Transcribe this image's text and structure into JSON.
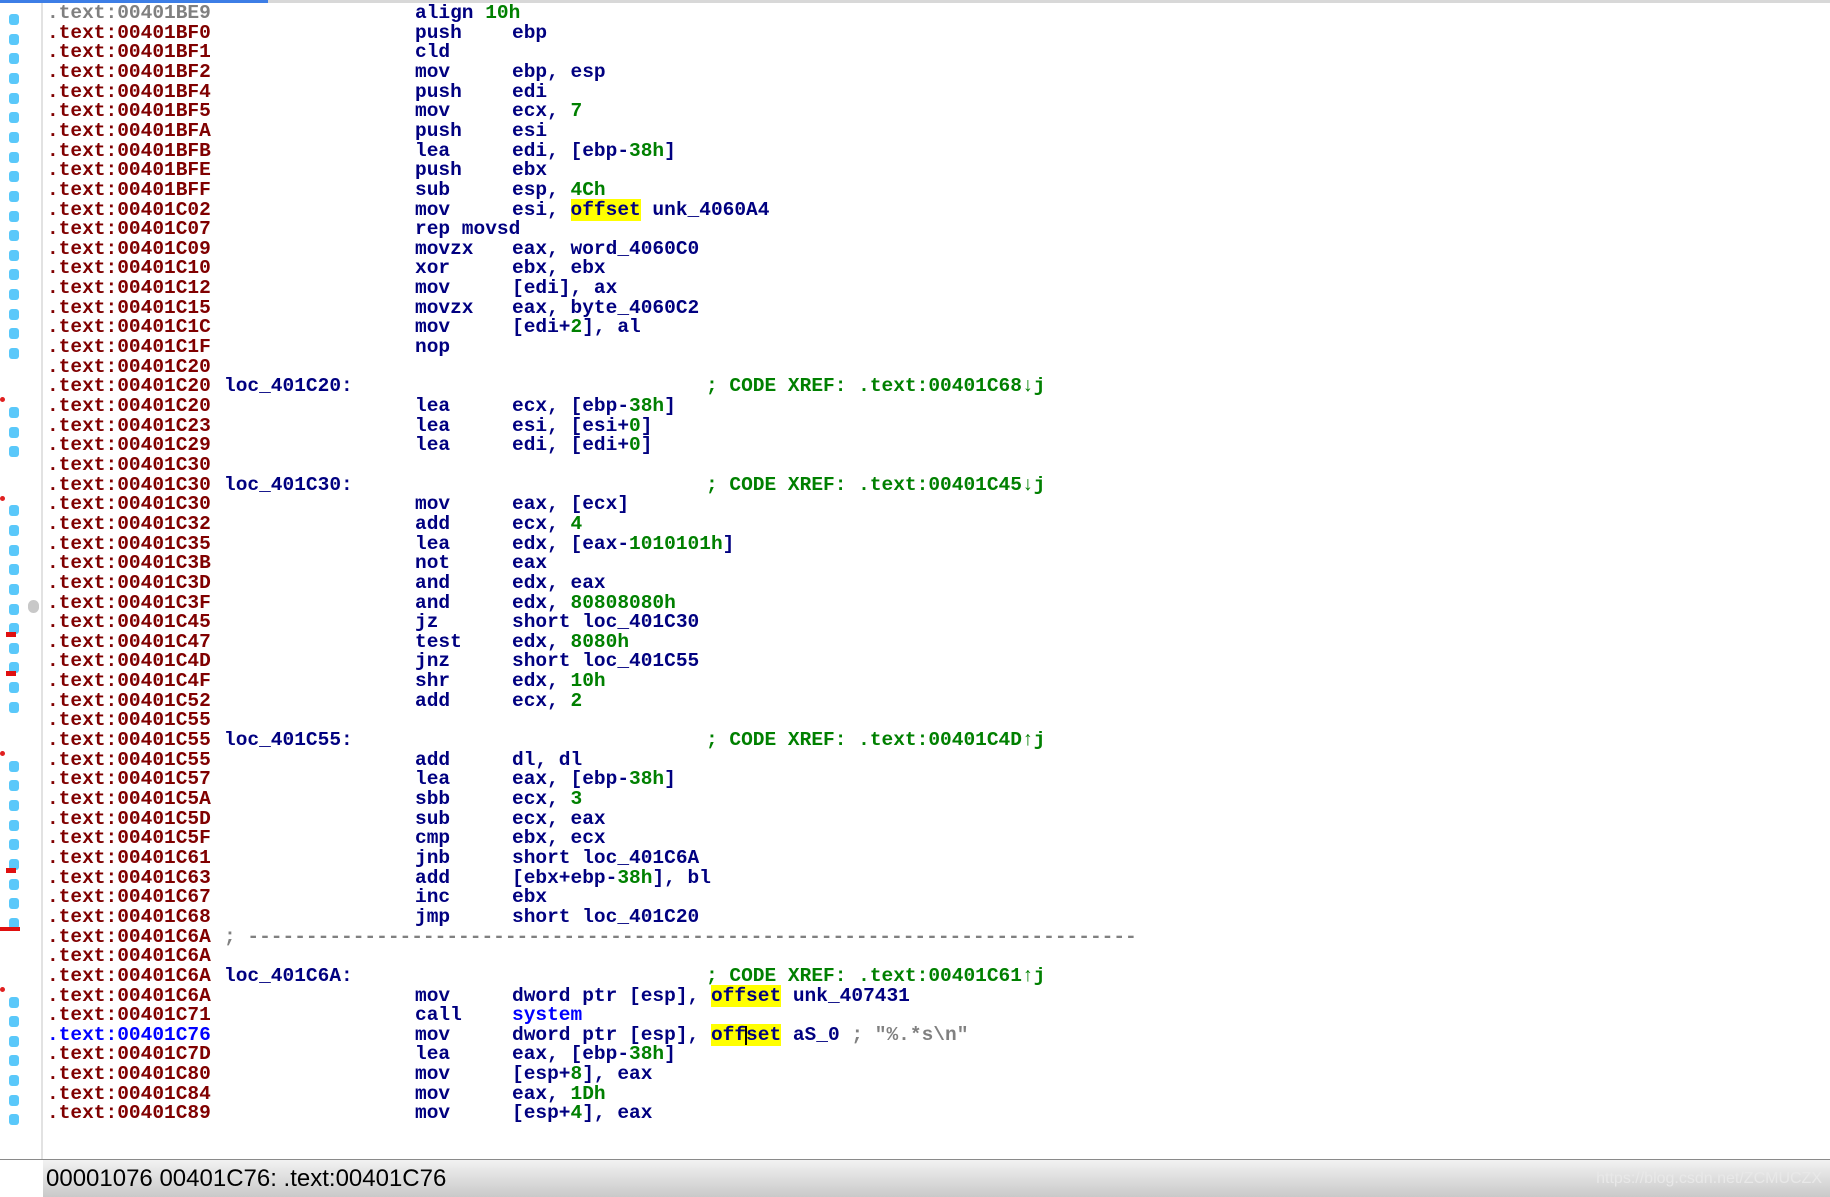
{
  "colors": {
    "address": "#800000",
    "address_dim": "#808080",
    "address_current": "#0000ff",
    "mnemonic": "#000080",
    "number": "#008000",
    "highlight": "#ffff00",
    "function": "#0000ff",
    "comment": "#808080",
    "xref": "#008000",
    "gutter_dot": "#5ac8fa"
  },
  "listing": [
    {
      "addr": ".text:00401BE9",
      "style": "grey",
      "mnem": "align",
      "inline": true,
      "ops": [
        [
          "10h",
          "n"
        ]
      ]
    },
    {
      "addr": ".text:00401BF0",
      "mnem": "push",
      "ops": [
        [
          "ebp",
          "r"
        ]
      ]
    },
    {
      "addr": ".text:00401BF1",
      "mnem": "cld",
      "ops": []
    },
    {
      "addr": ".text:00401BF2",
      "mnem": "mov",
      "ops": [
        [
          "ebp, esp",
          "r"
        ]
      ]
    },
    {
      "addr": ".text:00401BF4",
      "mnem": "push",
      "ops": [
        [
          "edi",
          "r"
        ]
      ]
    },
    {
      "addr": ".text:00401BF5",
      "mnem": "mov",
      "ops": [
        [
          "ecx, ",
          "r"
        ],
        [
          "7",
          "n"
        ]
      ]
    },
    {
      "addr": ".text:00401BFA",
      "mnem": "push",
      "ops": [
        [
          "esi",
          "r"
        ]
      ]
    },
    {
      "addr": ".text:00401BFB",
      "mnem": "lea",
      "ops": [
        [
          "edi, [ebp-",
          "r"
        ],
        [
          "38h",
          "n"
        ],
        [
          "]",
          "r"
        ]
      ]
    },
    {
      "addr": ".text:00401BFE",
      "mnem": "push",
      "ops": [
        [
          "ebx",
          "r"
        ]
      ]
    },
    {
      "addr": ".text:00401BFF",
      "mnem": "sub",
      "ops": [
        [
          "esp, ",
          "r"
        ],
        [
          "4Ch",
          "n"
        ]
      ]
    },
    {
      "addr": ".text:00401C02",
      "mnem": "mov",
      "ops": [
        [
          "esi, ",
          "r"
        ],
        [
          "offset",
          "o"
        ],
        [
          " unk_4060A4",
          "r"
        ]
      ]
    },
    {
      "addr": ".text:00401C07",
      "mnem": "rep movsd",
      "ops": []
    },
    {
      "addr": ".text:00401C09",
      "mnem": "movzx",
      "ops": [
        [
          "eax, word_4060C0",
          "r"
        ]
      ]
    },
    {
      "addr": ".text:00401C10",
      "mnem": "xor",
      "ops": [
        [
          "ebx, ebx",
          "r"
        ]
      ]
    },
    {
      "addr": ".text:00401C12",
      "mnem": "mov",
      "ops": [
        [
          "[edi], ax",
          "r"
        ]
      ]
    },
    {
      "addr": ".text:00401C15",
      "mnem": "movzx",
      "ops": [
        [
          "eax, byte_4060C2",
          "r"
        ]
      ]
    },
    {
      "addr": ".text:00401C1C",
      "mnem": "mov",
      "ops": [
        [
          "[edi+",
          "r"
        ],
        [
          "2",
          "n"
        ],
        [
          "], al",
          "r"
        ]
      ]
    },
    {
      "addr": ".text:00401C1F",
      "mnem": "nop",
      "ops": []
    },
    {
      "addr": ".text:00401C20"
    },
    {
      "addr": ".text:00401C20",
      "label": "loc_401C20:",
      "comment": "; CODE XREF: .text:00401C68↓j"
    },
    {
      "addr": ".text:00401C20",
      "mnem": "lea",
      "ops": [
        [
          "ecx, [ebp-",
          "r"
        ],
        [
          "38h",
          "n"
        ],
        [
          "]",
          "r"
        ]
      ]
    },
    {
      "addr": ".text:00401C23",
      "mnem": "lea",
      "ops": [
        [
          "esi, [esi+",
          "r"
        ],
        [
          "0",
          "n"
        ],
        [
          "]",
          "r"
        ]
      ]
    },
    {
      "addr": ".text:00401C29",
      "mnem": "lea",
      "ops": [
        [
          "edi, [edi+",
          "r"
        ],
        [
          "0",
          "n"
        ],
        [
          "]",
          "r"
        ]
      ]
    },
    {
      "addr": ".text:00401C30"
    },
    {
      "addr": ".text:00401C30",
      "label": "loc_401C30:",
      "comment": "; CODE XREF: .text:00401C45↓j"
    },
    {
      "addr": ".text:00401C30",
      "mnem": "mov",
      "ops": [
        [
          "eax, [ecx]",
          "r"
        ]
      ]
    },
    {
      "addr": ".text:00401C32",
      "mnem": "add",
      "ops": [
        [
          "ecx, ",
          "r"
        ],
        [
          "4",
          "n"
        ]
      ]
    },
    {
      "addr": ".text:00401C35",
      "mnem": "lea",
      "ops": [
        [
          "edx, [eax-",
          "r"
        ],
        [
          "1010101h",
          "n"
        ],
        [
          "]",
          "r"
        ]
      ]
    },
    {
      "addr": ".text:00401C3B",
      "mnem": "not",
      "ops": [
        [
          "eax",
          "r"
        ]
      ]
    },
    {
      "addr": ".text:00401C3D",
      "mnem": "and",
      "ops": [
        [
          "edx, eax",
          "r"
        ]
      ]
    },
    {
      "addr": ".text:00401C3F",
      "mnem": "and",
      "ops": [
        [
          "edx, ",
          "r"
        ],
        [
          "80808080h",
          "n"
        ]
      ]
    },
    {
      "addr": ".text:00401C45",
      "mnem": "jz",
      "ops": [
        [
          "short loc_401C30",
          "r"
        ]
      ]
    },
    {
      "addr": ".text:00401C47",
      "mnem": "test",
      "ops": [
        [
          "edx, ",
          "r"
        ],
        [
          "8080h",
          "n"
        ]
      ]
    },
    {
      "addr": ".text:00401C4D",
      "mnem": "jnz",
      "ops": [
        [
          "short loc_401C55",
          "r"
        ]
      ]
    },
    {
      "addr": ".text:00401C4F",
      "mnem": "shr",
      "ops": [
        [
          "edx, ",
          "r"
        ],
        [
          "10h",
          "n"
        ]
      ]
    },
    {
      "addr": ".text:00401C52",
      "mnem": "add",
      "ops": [
        [
          "ecx, ",
          "r"
        ],
        [
          "2",
          "n"
        ]
      ]
    },
    {
      "addr": ".text:00401C55"
    },
    {
      "addr": ".text:00401C55",
      "label": "loc_401C55:",
      "comment": "; CODE XREF: .text:00401C4D↑j"
    },
    {
      "addr": ".text:00401C55",
      "mnem": "add",
      "ops": [
        [
          "dl, dl",
          "r"
        ]
      ]
    },
    {
      "addr": ".text:00401C57",
      "mnem": "lea",
      "ops": [
        [
          "eax, [ebp-",
          "r"
        ],
        [
          "38h",
          "n"
        ],
        [
          "]",
          "r"
        ]
      ]
    },
    {
      "addr": ".text:00401C5A",
      "mnem": "sbb",
      "ops": [
        [
          "ecx, ",
          "r"
        ],
        [
          "3",
          "n"
        ]
      ]
    },
    {
      "addr": ".text:00401C5D",
      "mnem": "sub",
      "ops": [
        [
          "ecx, eax",
          "r"
        ]
      ]
    },
    {
      "addr": ".text:00401C5F",
      "mnem": "cmp",
      "ops": [
        [
          "ebx, ecx",
          "r"
        ]
      ]
    },
    {
      "addr": ".text:00401C61",
      "mnem": "jnb",
      "ops": [
        [
          "short loc_401C6A",
          "r"
        ]
      ]
    },
    {
      "addr": ".text:00401C63",
      "mnem": "add",
      "ops": [
        [
          "[ebx+ebp-",
          "r"
        ],
        [
          "38h",
          "n"
        ],
        [
          "], bl",
          "r"
        ]
      ]
    },
    {
      "addr": ".text:00401C67",
      "mnem": "inc",
      "ops": [
        [
          "ebx",
          "r"
        ]
      ]
    },
    {
      "addr": ".text:00401C68",
      "mnem": "jmp",
      "ops": [
        [
          "short loc_401C20",
          "r"
        ]
      ]
    },
    {
      "addr": ".text:00401C6A",
      "separator": "; ----------------------------------------------------------------------------"
    },
    {
      "addr": ".text:00401C6A"
    },
    {
      "addr": ".text:00401C6A",
      "label": "loc_401C6A:",
      "comment": "; CODE XREF: .text:00401C61↑j"
    },
    {
      "addr": ".text:00401C6A",
      "mnem": "mov",
      "ops": [
        [
          "dword ptr [esp], ",
          "r"
        ],
        [
          "offset",
          "o"
        ],
        [
          " unk_407431",
          "r"
        ]
      ]
    },
    {
      "addr": ".text:00401C71",
      "mnem": "call",
      "ops": [
        [
          "system",
          "f"
        ]
      ]
    },
    {
      "addr": ".text:00401C76",
      "style": "cur",
      "mnem": "mov",
      "ops": [
        [
          "dword ptr [esp], ",
          "r"
        ],
        [
          "offset",
          "o",
          3
        ],
        [
          " aS_0 ",
          "r"
        ],
        [
          "; \"%.*s\\n\"",
          "c"
        ]
      ]
    },
    {
      "addr": ".text:00401C7D",
      "mnem": "lea",
      "ops": [
        [
          "eax, [ebp-",
          "r"
        ],
        [
          "38h",
          "n"
        ],
        [
          "]",
          "r"
        ]
      ]
    },
    {
      "addr": ".text:00401C80",
      "mnem": "mov",
      "ops": [
        [
          "[esp+",
          "r"
        ],
        [
          "8",
          "n"
        ],
        [
          "], eax",
          "r"
        ]
      ]
    },
    {
      "addr": ".text:00401C84",
      "mnem": "mov",
      "ops": [
        [
          "eax, ",
          "r"
        ],
        [
          "1Dh",
          "n"
        ]
      ]
    },
    {
      "addr": ".text:00401C89",
      "mnem": "mov",
      "ops": [
        [
          "[esp+",
          "r"
        ],
        [
          "4",
          "n"
        ],
        [
          "], eax",
          "r"
        ]
      ]
    }
  ],
  "status": {
    "text": "00001076  00401C76: .text:00401C76",
    "watermark": "https://blog.csdn.net/ZCMUCZX"
  }
}
